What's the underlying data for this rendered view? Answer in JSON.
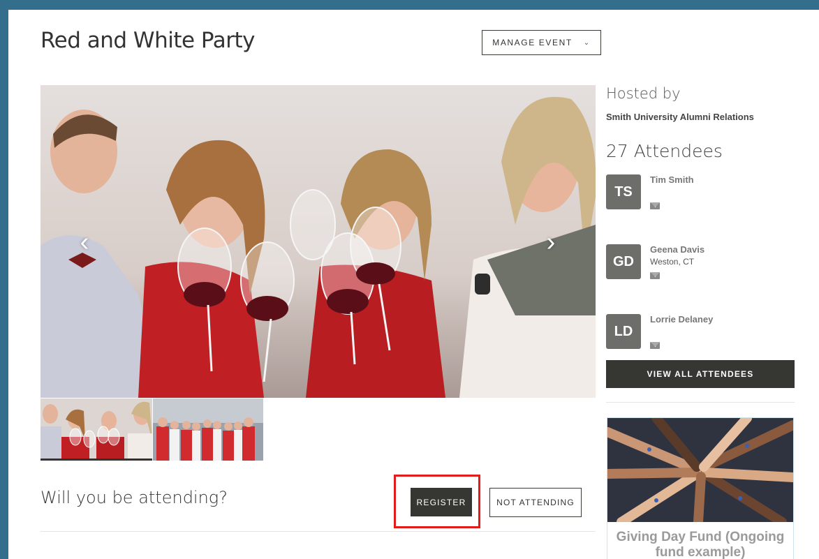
{
  "event": {
    "title": "Red and White Party",
    "manage_label": "MANAGE EVENT"
  },
  "gallery": {
    "prev_icon": "chevron-left-icon",
    "next_icon": "chevron-right-icon"
  },
  "rsvp": {
    "question": "Will you be attending?",
    "register_label": "REGISTER",
    "not_attending_label": "NOT ATTENDING"
  },
  "sidebar": {
    "hosted_by_heading": "Hosted by",
    "host_name": "Smith University Alumni Relations",
    "attendees_heading": "27 Attendees",
    "attendees": [
      {
        "initials": "TS",
        "name": "Tim Smith",
        "location": ""
      },
      {
        "initials": "GD",
        "name": "Geena Davis",
        "location": "Weston, CT"
      },
      {
        "initials": "LD",
        "name": "Lorrie Delaney",
        "location": ""
      }
    ],
    "view_all_label": "VIEW ALL ATTENDEES",
    "fund_title": "Giving Day Fund (Ongoing fund example)"
  },
  "colors": {
    "page_bg": "#336f8c",
    "dark_button": "#363632",
    "highlight": "#e21b1b",
    "avatar": "#6d6d6a"
  }
}
